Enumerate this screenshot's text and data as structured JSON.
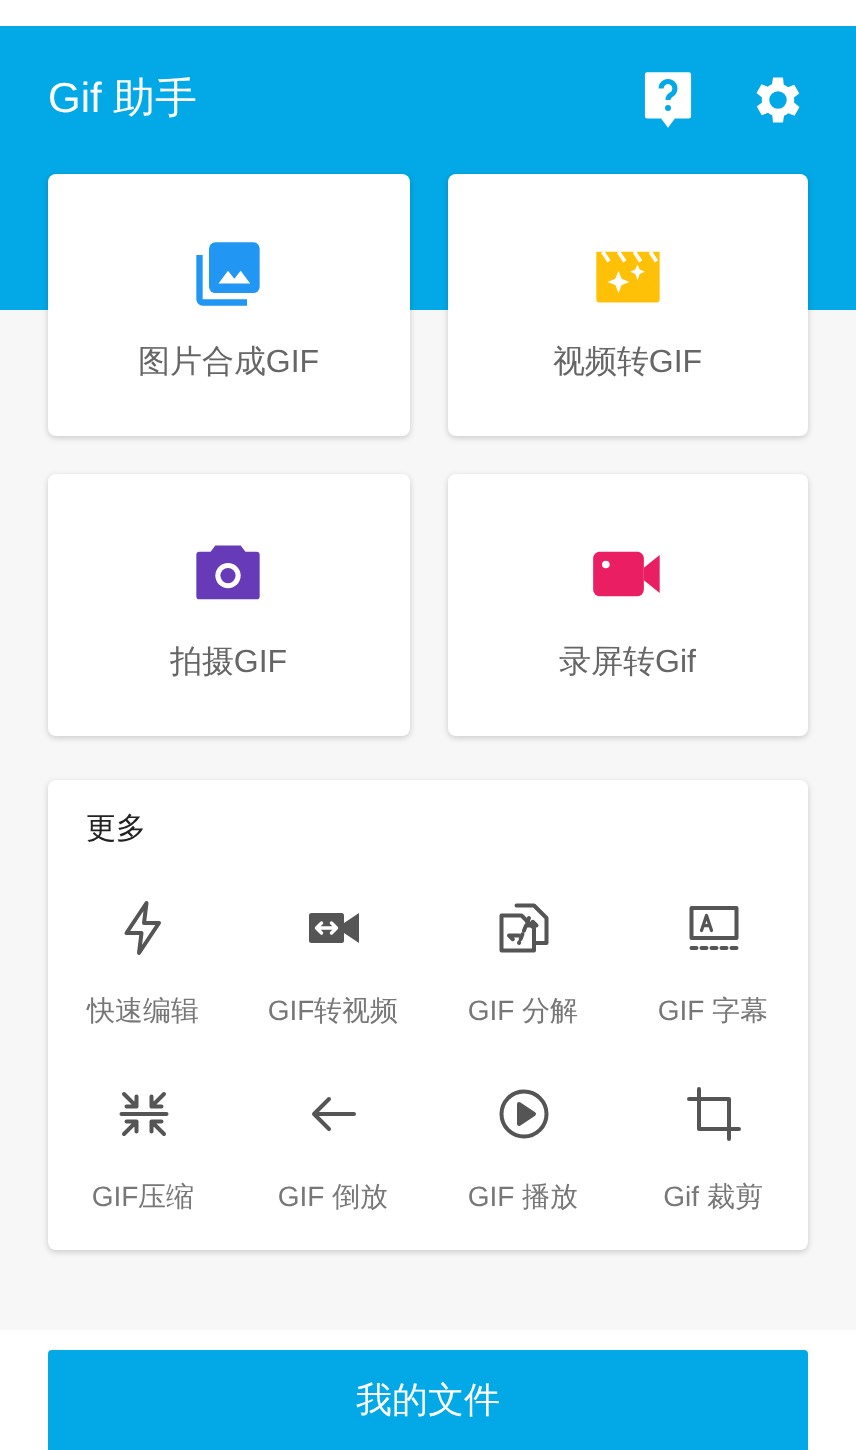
{
  "app_bar": {
    "title": "Gif 助手"
  },
  "main_actions": [
    {
      "kind": "images",
      "label": "图片合成GIF"
    },
    {
      "kind": "video",
      "label": "视频转GIF"
    },
    {
      "kind": "camera",
      "label": "拍摄GIF"
    },
    {
      "kind": "record",
      "label": "录屏转Gif"
    }
  ],
  "more": {
    "title": "更多",
    "tools": [
      {
        "kind": "bolt",
        "label": "快速编辑"
      },
      {
        "kind": "convert",
        "label": "GIF转视频"
      },
      {
        "kind": "split",
        "label": "GIF 分解"
      },
      {
        "kind": "caption",
        "label": "GIF 字幕"
      },
      {
        "kind": "compress",
        "label": "GIF压缩"
      },
      {
        "kind": "reverse",
        "label": "GIF 倒放"
      },
      {
        "kind": "play",
        "label": "GIF 播放"
      },
      {
        "kind": "crop",
        "label": "Gif 裁剪"
      }
    ]
  },
  "bottom_button": {
    "label": "我的文件"
  }
}
